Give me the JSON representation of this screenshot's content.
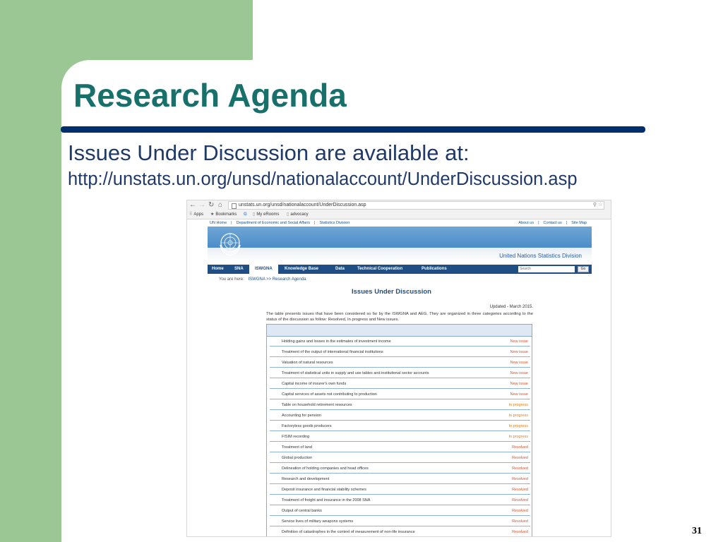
{
  "slide": {
    "title": "Research Agenda",
    "subtitle": "Issues Under Discussion are available at:",
    "url": "http://unstats.un.org/unsd/nationalaccount/UnderDiscussion.asp",
    "page_number": "31",
    "colors": {
      "title": "#17706a",
      "text": "#1f3a68",
      "rule": "#002f6c",
      "green": "#9bc795"
    }
  },
  "browser": {
    "address": "unstats.un.org/unsd/nationalaccount/UnderDiscussion.asp",
    "bookmarks": [
      "Apps",
      "Bookmarks",
      "My eRooms",
      "advocacy"
    ]
  },
  "un_page": {
    "top_links_left": [
      "UN Home",
      "|",
      "Department of Economic and Social Affairs",
      "|",
      "Statistics Division"
    ],
    "top_links_right": [
      "About us",
      "|",
      "Contact us",
      "|",
      "Site Map"
    ],
    "division_name": "United Nations Statistics Division",
    "nav": [
      "Home",
      "SNA",
      "ISWGNA",
      "Knowledge Base",
      "Data",
      "Technical Cooperation",
      "Publications"
    ],
    "active_nav": "ISWGNA",
    "search_placeholder": "Search",
    "search_button": "Go",
    "breadcrumb": [
      "You are here:",
      "ISWGNA >> Research Agenda"
    ],
    "heading": "Issues Under Discussion",
    "updated": "Updated - March 2015.",
    "intro": "The table presents issues that have been considered so far by the ISWGNA and AEG. They are organized in three categories according to the status of the discussion as follow: Resolved, In progress and New issues.",
    "issues": [
      {
        "name": "Holding gains and losses in the estimates of investment income",
        "status": "New issue"
      },
      {
        "name": "Treatment of the output of international financial institutions",
        "status": "New issue"
      },
      {
        "name": "Valuation of natural resources",
        "status": "New issue"
      },
      {
        "name": "Treatment of statistical units in supply and use tables and institutional sector accounts",
        "status": "New issue"
      },
      {
        "name": "Capital income of insurer's own funds",
        "status": "New issue"
      },
      {
        "name": "Capital services of assets not contributing to production",
        "status": "New issue"
      },
      {
        "name": "Table on household retirement resources",
        "status": "In progress"
      },
      {
        "name": "Accounting for pension",
        "status": "In progress"
      },
      {
        "name": "Factoryless goods producers",
        "status": "In progress"
      },
      {
        "name": "FISIM recording",
        "status": "In progress"
      },
      {
        "name": "Treatment of land",
        "status": "Resolved"
      },
      {
        "name": "Global production",
        "status": "Resolved"
      },
      {
        "name": "Delineation of holding companies and head offices",
        "status": "Resolved"
      },
      {
        "name": "Research and development",
        "status": "Resolved"
      },
      {
        "name": "Deposit insurance and financial stability schemes",
        "status": "Resolved"
      },
      {
        "name": "Treatment of freight and insurance in the 2008 SNA",
        "status": "Resolved"
      },
      {
        "name": "Output of central banks",
        "status": "Resolved"
      },
      {
        "name": "Service lives of military weapons systems",
        "status": "Resolved"
      },
      {
        "name": "Definition of catastrophes in the context of measurement of non-life insurance",
        "status": "Resolved"
      }
    ]
  }
}
